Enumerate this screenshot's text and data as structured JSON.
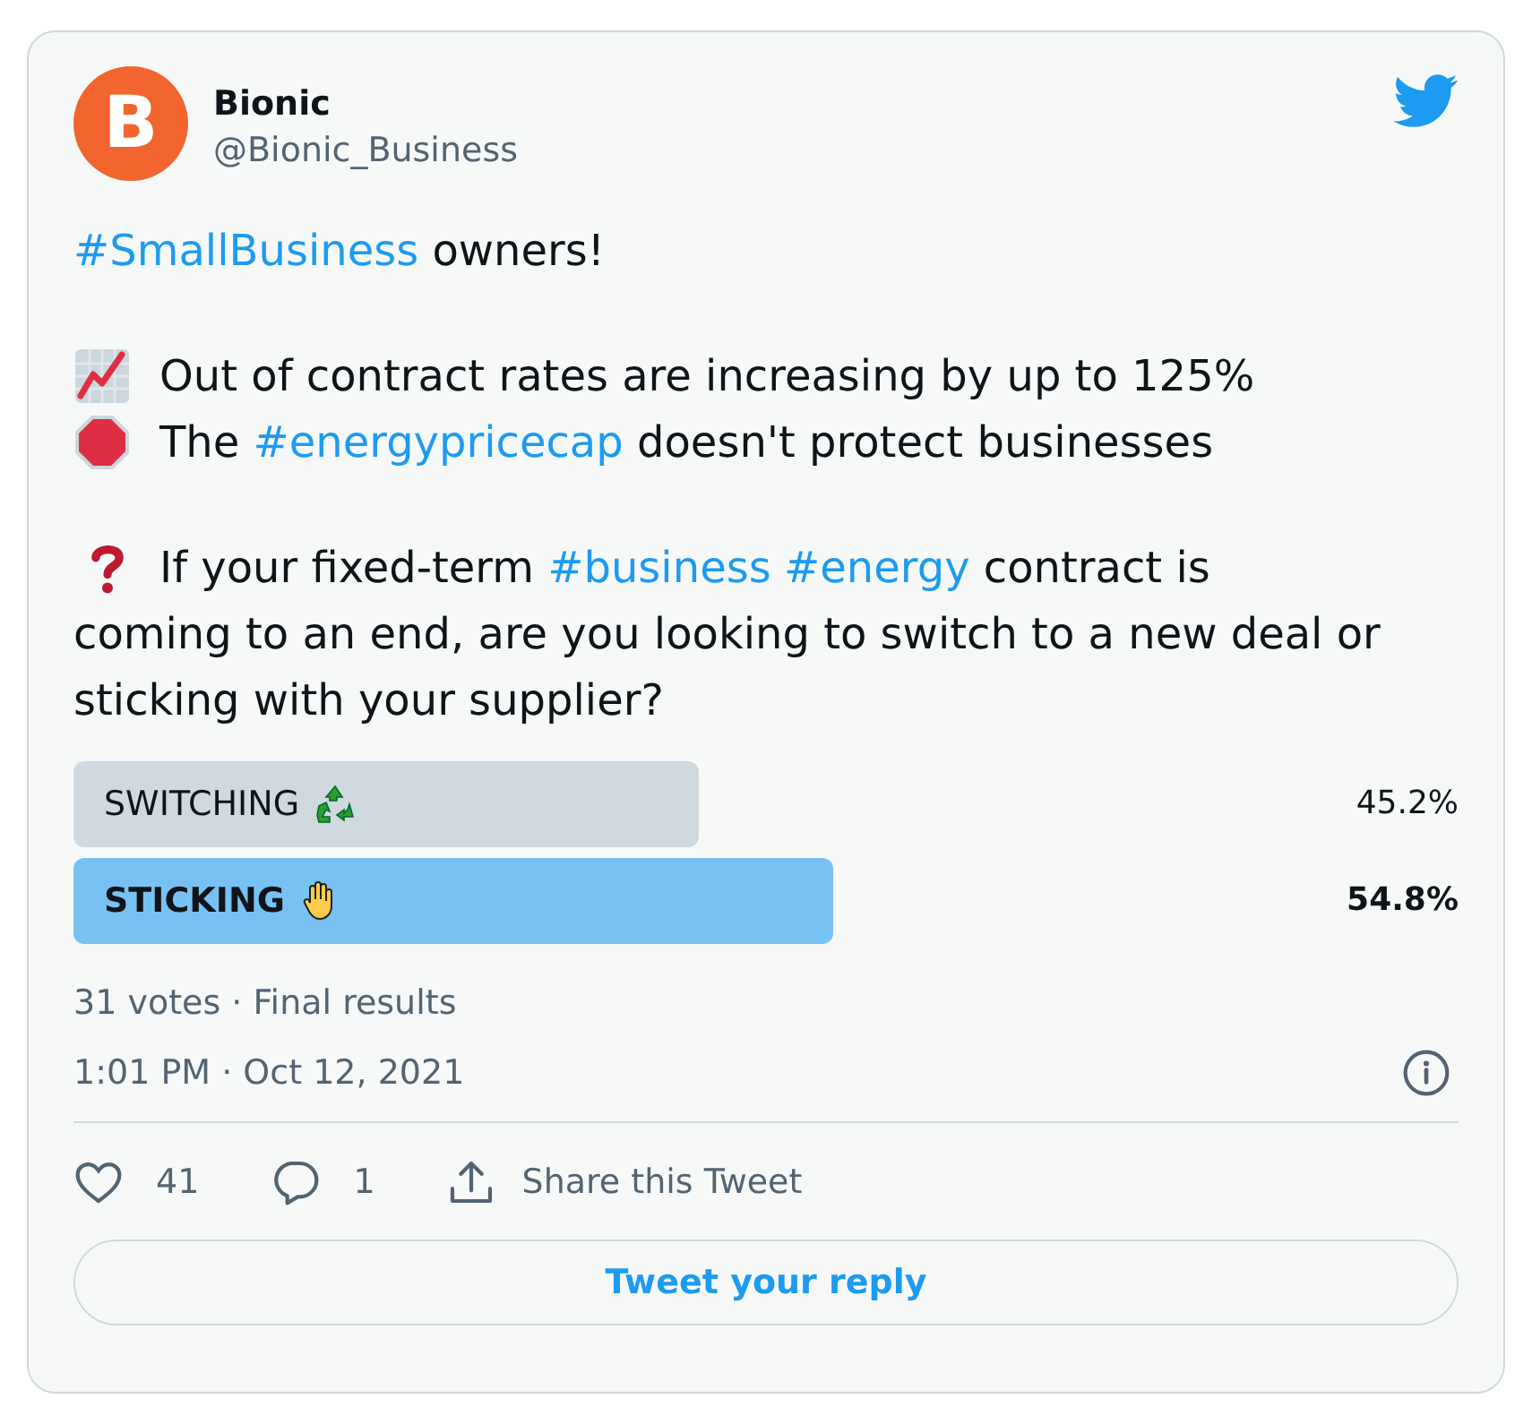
{
  "author": {
    "name": "Bionic",
    "handle": "@Bionic_Business",
    "avatar_letter": "B"
  },
  "tweet": [
    {
      "kind": "plain",
      "parts": [
        {
          "kind": "hashtag",
          "text": "#SmallBusiness"
        },
        {
          "kind": "text",
          "text": " owners!"
        }
      ]
    },
    {
      "kind": "trend",
      "parts": [
        {
          "kind": "text",
          "text": "Out of contract rates are increasing by up to 125%"
        }
      ]
    },
    {
      "kind": "stop",
      "parts": [
        {
          "kind": "text",
          "text": "The "
        },
        {
          "kind": "hashtag",
          "text": "#energypricecap"
        },
        {
          "kind": "text",
          "text": " doesn't protect businesses"
        }
      ]
    },
    {
      "kind": "question",
      "parts": [
        {
          "kind": "text",
          "text": "If your fixed-term "
        },
        {
          "kind": "hashtag",
          "text": "#business"
        },
        {
          "kind": "hashtag",
          "text": "#energy"
        },
        {
          "kind": "text",
          "text": " contract is"
        }
      ]
    },
    {
      "kind": "plain",
      "parts": [
        {
          "kind": "text",
          "text": "coming to an end, are you looking to switch to a new deal or sticking with your supplier?"
        }
      ]
    }
  ],
  "poll": {
    "options": [
      {
        "label": "SWITCHING",
        "kind": "recycle",
        "percent": "45.2%",
        "selected": false
      },
      {
        "label": "STICKING",
        "kind": "hand",
        "percent": "54.8%",
        "selected": true
      }
    ],
    "summary": "31 votes · Final results"
  },
  "timestamp": "1:01 PM · Oct 12, 2021",
  "actions": {
    "likes": "41",
    "replies": "1",
    "share": "Share this Tweet"
  },
  "reply_button": "Tweet your reply"
}
